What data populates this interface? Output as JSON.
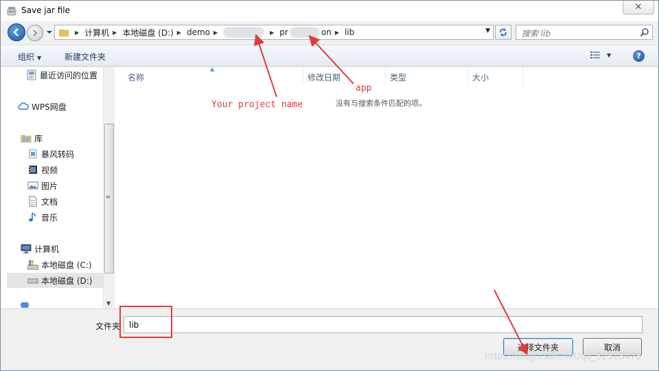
{
  "window": {
    "title": "Save jar file",
    "close_glyph": "✕"
  },
  "address": {
    "crumbs": [
      "计算机",
      "本地磁盘 (D:)",
      "demo",
      "pr",
      "on",
      "lib"
    ],
    "search_placeholder": "搜索 lib"
  },
  "toolbar": {
    "organize_label": "组织",
    "new_folder_label": "新建文件夹",
    "help_glyph": "?"
  },
  "sidebar": {
    "items": [
      {
        "label": "最近访问的位置",
        "icon": "recent-places-icon"
      },
      {
        "label": "WPS网盘",
        "icon": "cloud-icon"
      },
      {
        "label": "库",
        "icon": "library-icon"
      },
      {
        "label": "暴风转码",
        "icon": "library-folder-icon"
      },
      {
        "label": "视频",
        "icon": "video-icon"
      },
      {
        "label": "图片",
        "icon": "picture-icon"
      },
      {
        "label": "文档",
        "icon": "document-icon"
      },
      {
        "label": "音乐",
        "icon": "music-icon"
      },
      {
        "label": "计算机",
        "icon": "computer-icon"
      },
      {
        "label": "本地磁盘 (C:)",
        "icon": "drive-c-icon"
      },
      {
        "label": "本地磁盘 (D:)",
        "icon": "drive-d-icon"
      }
    ]
  },
  "filelist": {
    "columns": [
      "名称",
      "修改日期",
      "类型",
      "大小"
    ],
    "empty_message": "没有与搜索条件匹配的项。"
  },
  "bottom": {
    "folder_label": "文件夹",
    "folder_value": "lib",
    "select_button": "选择文件夹",
    "cancel_button": "取消"
  },
  "annotations": {
    "project_name": "Your project name",
    "app": "app",
    "accent_color": "#e03a3a"
  },
  "watermark": "https://blog.csdn.net/qq_32518478"
}
